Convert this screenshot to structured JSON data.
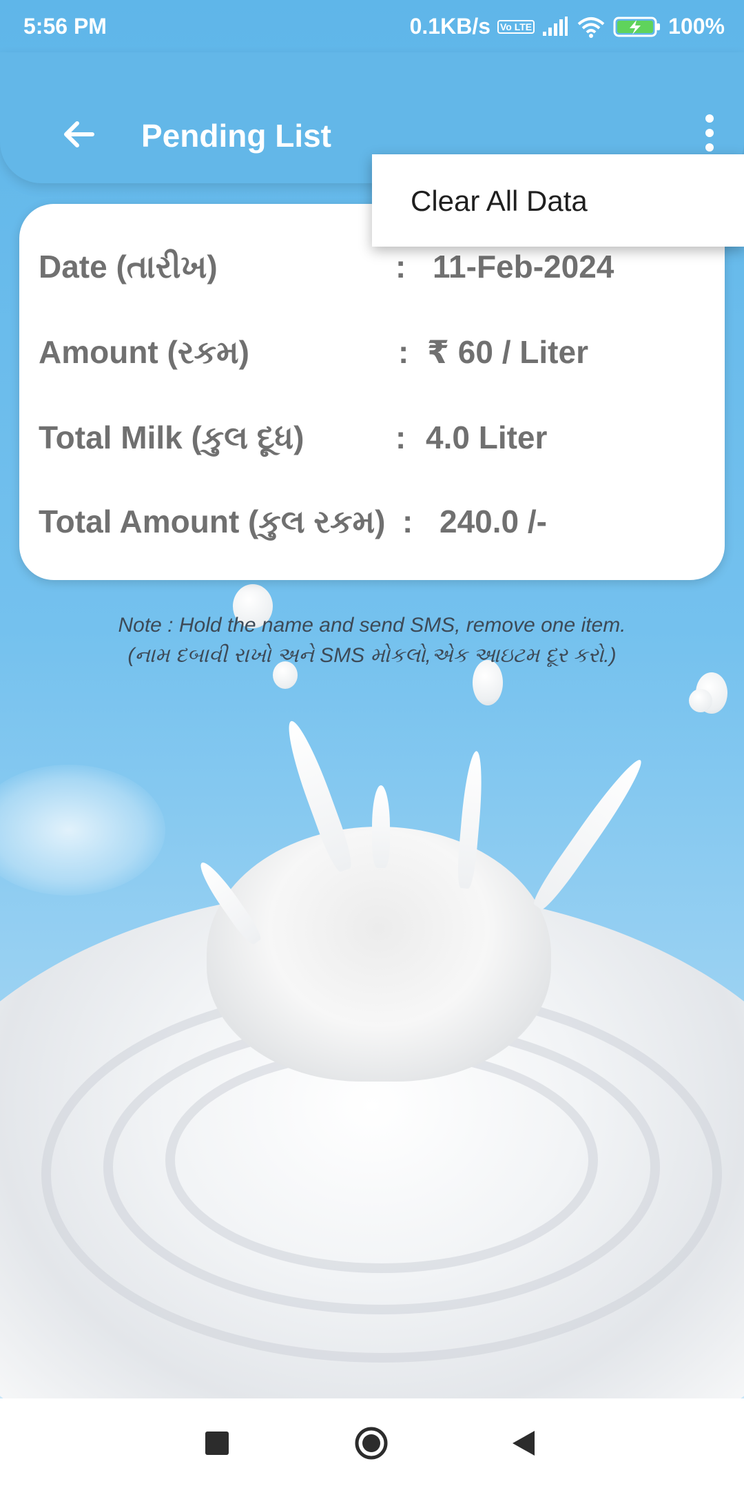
{
  "status_bar": {
    "time": "5:56 PM",
    "network_speed": "0.1KB/s",
    "volte_badge": "Vo LTE",
    "battery": "100%",
    "icons": [
      "volte-icon",
      "signal-icon",
      "wifi-icon",
      "battery-charging-icon"
    ]
  },
  "app_bar": {
    "title": "Pending List",
    "back_icon": "arrow-left-icon",
    "menu_icon": "more-vertical-icon",
    "background_color": "#63b7e8"
  },
  "overflow_menu": {
    "items": [
      {
        "label": "Clear All Data"
      }
    ]
  },
  "details_card": {
    "rows": [
      {
        "label": "Date (તારીખ)",
        "separator": ":",
        "value": "11-Feb-2024"
      },
      {
        "label": "Amount (રકમ)",
        "separator": ":",
        "value": "₹ 60 / Liter"
      },
      {
        "label": "Total Milk (કુલ દૂધ)",
        "separator": ":",
        "value": "4.0 Liter"
      },
      {
        "label": "Total Amount (કુલ રકમ)",
        "separator": ":",
        "value": "240.0 /-"
      }
    ],
    "text_color": "#707070"
  },
  "note": {
    "line1": "Note : Hold the name and send SMS, remove one item.",
    "line2": "(નામ દબાવી રાખો અને SMS મોકલો,એક આઇટમ દૂર કરો.)"
  },
  "nav_bar": {
    "icons": [
      "recents-square-icon",
      "home-circle-icon",
      "back-triangle-icon"
    ]
  }
}
